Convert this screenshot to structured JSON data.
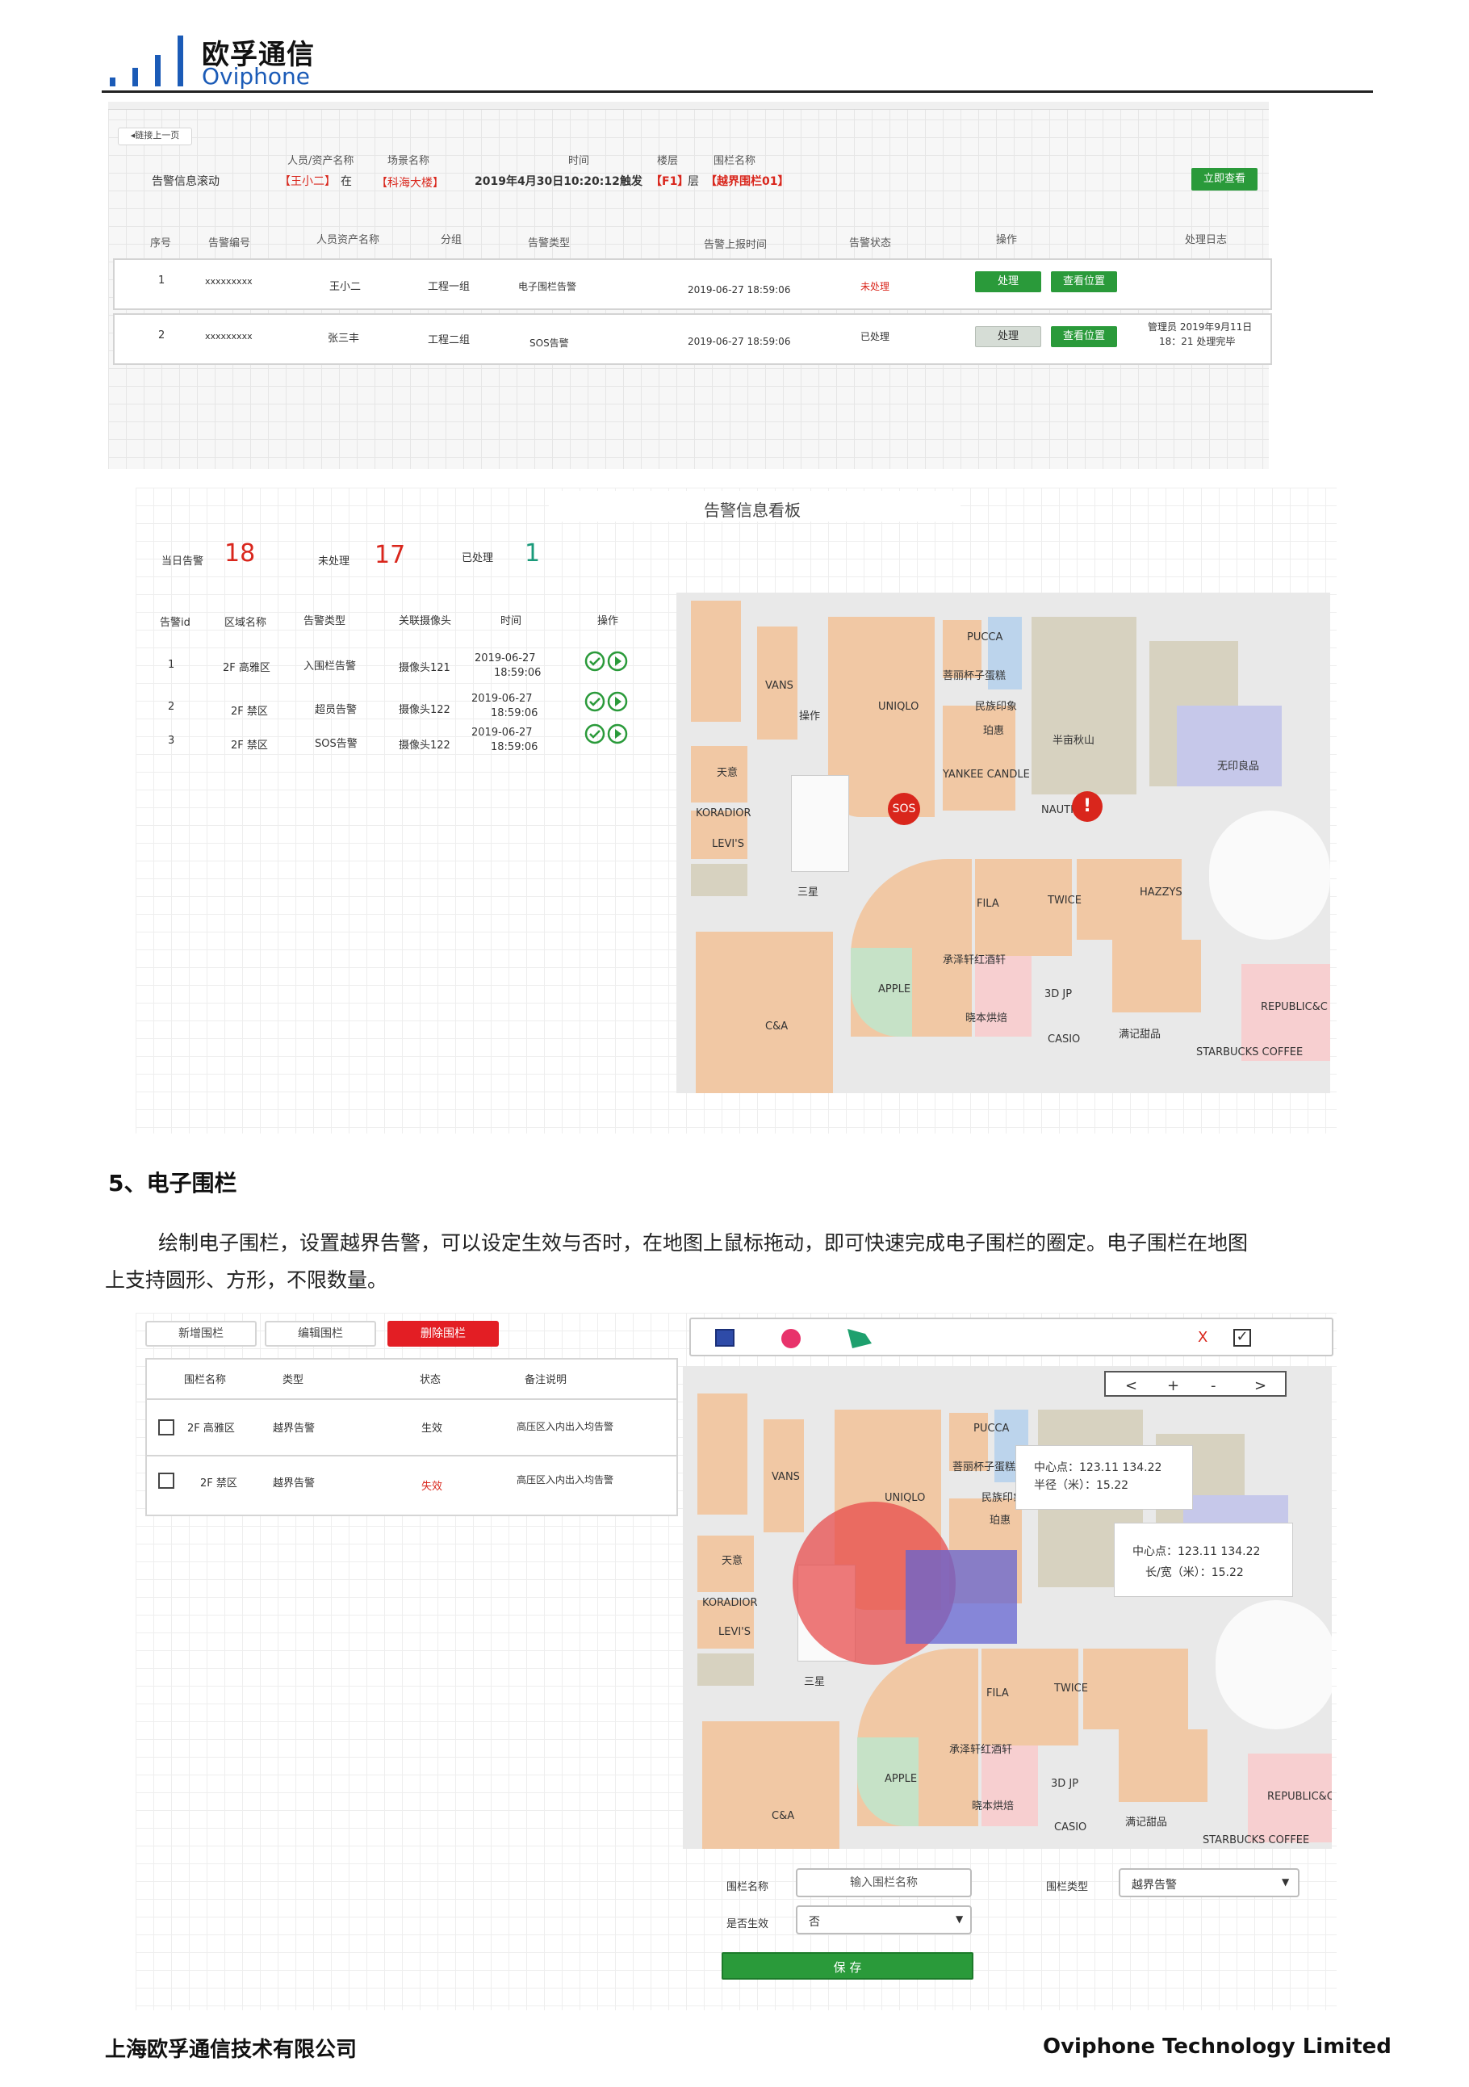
{
  "header": {
    "brand_cn": "欧孚通信",
    "brand_en": "Oviphone"
  },
  "panel1": {
    "back_button": "◂链接上一页",
    "col_labels": {
      "person": "人员/资产名称",
      "scene": "场景名称",
      "time": "时间",
      "floor": "楼层",
      "fence": "围栏名称"
    },
    "scroll_label": "告警信息滚动",
    "scroll_person": "【王小二】",
    "scroll_in": "在",
    "scroll_scene": "【科海大楼】",
    "scroll_time": "2019年4月30日10:20:12",
    "scroll_trigger": "触发",
    "scroll_floor": "【F1】",
    "scroll_ceng": "层",
    "scroll_fence": "【越界围栏01】",
    "view_now": "立即查看",
    "table_headers": [
      "序号",
      "告警编号",
      "人员资产名称",
      "分组",
      "告警类型",
      "告警上报时间",
      "告警状态",
      "操作",
      "处理日志"
    ],
    "rows": [
      {
        "no": "1",
        "code": "xxxxxxxxx",
        "name": "王小二",
        "group": "工程一组",
        "type": "电子围栏告警",
        "time": "2019-06-27 18:59:06",
        "status": "未处理",
        "btn1": "处理",
        "btn2": "查看位置",
        "log1": "",
        "log2": ""
      },
      {
        "no": "2",
        "code": "xxxxxxxxx",
        "name": "张三丰",
        "group": "工程二组",
        "type": "SOS告警",
        "time": "2019-06-27 18:59:06",
        "status": "已处理",
        "btn1": "处理",
        "btn2": "查看位置",
        "log1": "管理员 2019年9月11日",
        "log2": "18：21 处理完毕"
      }
    ]
  },
  "panel2": {
    "title": "告警信息看板",
    "stat_today_label": "当日告警",
    "stat_today": "18",
    "stat_unhandled_label": "未处理",
    "stat_unhandled": "17",
    "stat_handled_label": "已处理",
    "stat_handled": "1",
    "headers": [
      "告警id",
      "区域名称",
      "告警类型",
      "关联摄像头",
      "时间",
      "操作"
    ],
    "rows": [
      {
        "id": "1",
        "area": "2F 高雅区",
        "type": "入围栏告警",
        "cam": "摄像头121",
        "date": "2019-06-27",
        "time": "18:59:06"
      },
      {
        "id": "2",
        "area": "2F 禁区",
        "type": "超员告警",
        "cam": "摄像头122",
        "date": "2019-06-27",
        "time": "18:59:06"
      },
      {
        "id": "3",
        "area": "2F 禁区",
        "type": "SOS告警",
        "cam": "摄像头122",
        "date": "2019-06-27",
        "time": "18:59:06"
      }
    ],
    "map_extra_label": "操作",
    "sos": "SOS"
  },
  "map": {
    "labels": [
      "PUCCA",
      "VANS",
      "UNIQLO",
      "菩丽杯子蛋糕",
      "民族印象",
      "珀惠",
      "半亩秋山",
      "无印良品",
      "天意",
      "YANKEE CANDLE",
      "KORADIOR",
      "NAUTICA",
      "LEVI'S",
      "三星",
      "FILA",
      "TWICE",
      "HAZZYS",
      "承泽轩红酒轩",
      "APPLE",
      "3D JP",
      "REPUBLIC&C",
      "晓本烘焙",
      "C&A",
      "CASIO",
      "满记甜品",
      "STARBUCKS COFFEE"
    ]
  },
  "section": {
    "heading": "5、电子围栏",
    "para1": "绘制电子围栏，设置越界告警，可以设定生效与否时，在地图上鼠标拖动，即可快速完成电子围栏的圈定。电子围栏在地图",
    "para2": "上支持圆形、方形，不限数量。"
  },
  "panel3": {
    "btn_add": "新增围栏",
    "btn_edit": "编辑围栏",
    "btn_delete": "删除围栏",
    "headers": [
      "围栏名称",
      "类型",
      "状态",
      "备注说明"
    ],
    "rows": [
      {
        "name": "2F 高雅区",
        "type": "越界告警",
        "status": "生效",
        "note": "高压区入内出入均告警"
      },
      {
        "name": "2F 禁区",
        "type": "越界告警",
        "status": "失效",
        "note": "高压区入内出入均告警"
      }
    ],
    "toolbar_x": "X",
    "nav": [
      "<",
      "+",
      "-",
      ">"
    ],
    "tip_circle_center": "中心点：123.11  134.22",
    "tip_circle_radius": "半径（米）：15.22",
    "tip_rect_center": "中心点：123.11  134.22",
    "tip_rect_size": "长/宽（米）：15.22",
    "form_name_label": "围栏名称",
    "form_name_placeholder": "输入围栏名称",
    "form_type_label": "围栏类型",
    "form_type_value": "越界告警",
    "form_active_label": "是否生效",
    "form_active_value": "否",
    "save": "保 存"
  },
  "footer": {
    "left": "上海欧孚通信技术有限公司",
    "right": "Oviphone Technology Limited"
  }
}
